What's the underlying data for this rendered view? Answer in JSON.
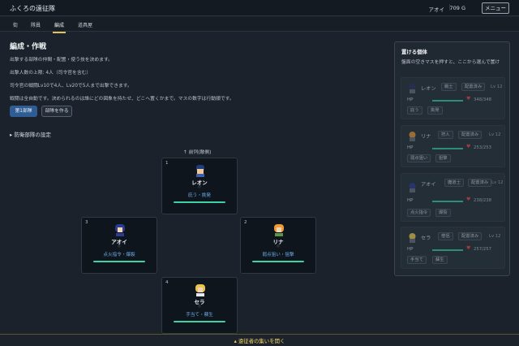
{
  "app": {
    "title": "ふくろの遠征隊",
    "user": "アオイ",
    "separator": "|",
    "gold": "709 G",
    "menu_label": "メニュー"
  },
  "tabs": [
    {
      "label": "街",
      "active": false
    },
    {
      "label": "隊員",
      "active": false
    },
    {
      "label": "編成",
      "active": true
    },
    {
      "label": "道具屋",
      "active": false
    }
  ],
  "main": {
    "title": "編成・作戦",
    "desc1": "出撃する部隊の仲間・配置・使う技を決めます。",
    "desc2": "出撃人数の上限: 4人（司令官を含む）",
    "desc3": "司令官の戦闘Lv10で4人、Lv20で5人まで出撃できます。",
    "desc4": "戦闘は全自動です。決められるのは誰にどの図象を持たせ、どこへ置くかまで。マスの数字は行動順です。",
    "squad_button": "第1部隊",
    "create_button": "部隊を作る",
    "defense_label": "防衛部隊の設定",
    "front_label": "↑ 前列(敵側)"
  },
  "slots": [
    {
      "number": "1",
      "name": "レオン",
      "mark": "◇",
      "skills": "庇う・挑発",
      "accent": "#1f3c7b"
    },
    {
      "number": "3",
      "name": "アオイ",
      "mark": "◇",
      "skills": "点火指令・爆裂",
      "accent": "#2b3d8f"
    },
    {
      "number": "2",
      "name": "リナ",
      "mark": "◇",
      "skills": "弱点狙い・狙撃",
      "accent": "#ee9a34"
    },
    {
      "number": "4",
      "name": "セラ",
      "mark": "◇",
      "skills": "手当て・蘇生",
      "accent": "#e8c44f"
    }
  ],
  "side": {
    "title": "置ける個体",
    "desc": "盤面の空きマスを押すと、ここから選んで置け",
    "cards": [
      {
        "name": "レオン",
        "role": "戦士",
        "status": "配置済み",
        "lv": "Lv 12",
        "hp_label": "HP",
        "hp": "348/348",
        "skill1": "庇う",
        "skill2": "挑発",
        "color": "#28345f"
      },
      {
        "name": "リナ",
        "role": "狩人",
        "status": "配置済み",
        "lv": "Lv 12",
        "hp_label": "HP",
        "hp": "253/253",
        "skill1": "弱点狙い",
        "skill2": "狙撃",
        "color": "#df9133"
      },
      {
        "name": "アオイ",
        "role": "魔道士",
        "status": "配置済み",
        "lv": "Lv 12",
        "hp_label": "HP",
        "hp": "238/238",
        "skill1": "点火指令",
        "skill2": "爆裂",
        "color": "#2d3c87"
      },
      {
        "name": "セラ",
        "role": "僧侶",
        "status": "配置済み",
        "lv": "Lv 12",
        "hp_label": "HP",
        "hp": "257/257",
        "skill1": "手当て",
        "skill2": "蘇生",
        "color": "#e6c24e"
      }
    ]
  },
  "bottom": {
    "label": "▴ 遠征者の集いを開く"
  },
  "colors": {
    "accent": "#e2c25a",
    "primary": "#2f5d93",
    "hp": "#3fd0a3",
    "skill_text": "#6fb0ea"
  }
}
